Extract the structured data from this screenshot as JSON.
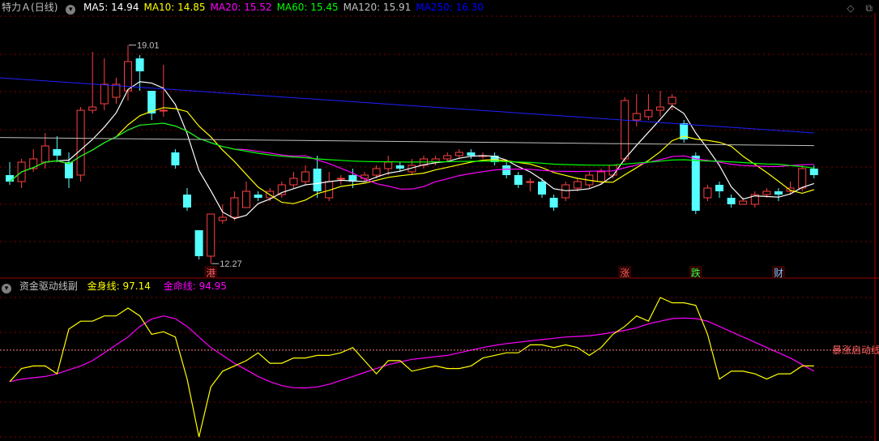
{
  "main_panel": {
    "stock_name": "特力Ａ",
    "period": "(日线)",
    "ma_items": [
      {
        "label": "MA5: ",
        "value": "14.94",
        "color": "#ffffff"
      },
      {
        "label": "MA10: ",
        "value": "14.85",
        "color": "#ffff00"
      },
      {
        "label": "MA20: ",
        "value": "15.52",
        "color": "#ff00ff"
      },
      {
        "label": "MA60: ",
        "value": "15.45",
        "color": "#00ff00"
      },
      {
        "label": "MA120: ",
        "value": "15.91",
        "color": "#c0c0c0"
      },
      {
        "label": "MA250: ",
        "value": "16.30",
        "color": "#0000ff"
      }
    ],
    "high_label": "19.01",
    "low_label": "12.27",
    "markers": [
      {
        "text": "港",
        "color": "#ff6060",
        "day": 17
      },
      {
        "text": "涨",
        "color": "#ff6060",
        "day": 52
      },
      {
        "text": "跌",
        "color": "#40ff40",
        "day": 58
      },
      {
        "text": "财",
        "color": "#80c0ff",
        "day": 65
      }
    ]
  },
  "sub_panel": {
    "indicator_name": "资金驱动线副",
    "line1_label": "金身线: ",
    "line1_value": "97.14",
    "line2_label": "金命线: ",
    "line2_value": "94.95",
    "annotation": "暴涨启动线"
  },
  "colors": {
    "up": "#ff4040",
    "down": "#54ffff",
    "ma5": "#ffffff",
    "ma10": "#ffff00",
    "ma20": "#ff00ff",
    "ma60": "#00ff00",
    "ma120": "#c0c0c0",
    "ma250": "#2020ff",
    "grid": "#800000",
    "gold_line": "#ffff00",
    "life_line": "#ff00ff"
  },
  "chart_data": [
    {
      "type": "candlestick",
      "ylim": [
        11.9,
        19.9
      ],
      "candles": [
        [
          15.0,
          14.8,
          15.4,
          14.7
        ],
        [
          14.8,
          15.4,
          15.5,
          14.6
        ],
        [
          15.2,
          15.5,
          15.8,
          15.1
        ],
        [
          15.4,
          15.9,
          16.3,
          15.2
        ],
        [
          15.8,
          15.6,
          16.2,
          15.4
        ],
        [
          15.4,
          14.9,
          15.7,
          14.6
        ],
        [
          15.0,
          17.0,
          17.1,
          14.8
        ],
        [
          17.0,
          17.1,
          18.8,
          16.9
        ],
        [
          17.2,
          17.8,
          18.6,
          17.0
        ],
        [
          17.4,
          17.8,
          18.0,
          17.2
        ],
        [
          17.6,
          18.5,
          19.01,
          17.3
        ],
        [
          18.6,
          18.2,
          18.7,
          17.6
        ],
        [
          17.6,
          16.9,
          17.4,
          16.7
        ],
        [
          17.0,
          17.0,
          18.4,
          16.8
        ],
        [
          15.7,
          15.3,
          15.8,
          15.2
        ],
        [
          14.4,
          14.0,
          14.6,
          13.9
        ],
        [
          13.3,
          12.5,
          13.3,
          12.4
        ],
        [
          12.5,
          13.8,
          13.8,
          12.27
        ],
        [
          13.6,
          13.7,
          14.1,
          13.5
        ],
        [
          13.7,
          14.3,
          14.5,
          13.6
        ],
        [
          14.0,
          14.5,
          14.8,
          14.0
        ],
        [
          14.4,
          14.3,
          14.5,
          14.2
        ],
        [
          14.3,
          14.5,
          14.6,
          14.2
        ],
        [
          14.4,
          14.7,
          14.8,
          14.3
        ],
        [
          14.7,
          14.9,
          15.1,
          14.6
        ],
        [
          14.8,
          15.1,
          15.3,
          14.7
        ],
        [
          15.2,
          14.5,
          15.6,
          14.3
        ],
        [
          14.3,
          14.8,
          15.1,
          14.2
        ],
        [
          14.9,
          14.9,
          15.0,
          14.7
        ],
        [
          15.0,
          14.8,
          15.2,
          14.6
        ],
        [
          14.9,
          15.0,
          15.1,
          14.8
        ],
        [
          15.0,
          15.2,
          15.3,
          14.9
        ],
        [
          15.2,
          15.4,
          15.6,
          15.0
        ],
        [
          15.3,
          15.2,
          15.4,
          15.1
        ],
        [
          15.1,
          15.3,
          15.5,
          15.0
        ],
        [
          15.3,
          15.5,
          15.6,
          15.2
        ],
        [
          15.4,
          15.5,
          15.6,
          15.3
        ],
        [
          15.5,
          15.6,
          15.7,
          15.4
        ],
        [
          15.6,
          15.7,
          15.8,
          15.5
        ],
        [
          15.7,
          15.6,
          15.8,
          15.5
        ],
        [
          15.6,
          15.6,
          15.7,
          15.5
        ],
        [
          15.6,
          15.4,
          15.7,
          15.3
        ],
        [
          15.3,
          15.0,
          15.4,
          14.9
        ],
        [
          15.0,
          14.7,
          15.1,
          14.6
        ],
        [
          14.8,
          14.8,
          14.9,
          14.5
        ],
        [
          14.8,
          14.4,
          14.9,
          14.3
        ],
        [
          14.3,
          14.0,
          14.4,
          13.9
        ],
        [
          14.3,
          14.7,
          14.8,
          14.2
        ],
        [
          14.6,
          14.8,
          14.9,
          14.5
        ],
        [
          14.7,
          15.0,
          15.1,
          14.6
        ],
        [
          14.8,
          15.1,
          15.2,
          14.7
        ],
        [
          15.0,
          15.3,
          15.3,
          14.9
        ],
        [
          15.5,
          17.3,
          17.4,
          15.4
        ],
        [
          16.7,
          16.9,
          17.5,
          16.5
        ],
        [
          16.8,
          17.0,
          17.5,
          16.7
        ],
        [
          17.0,
          17.1,
          17.6,
          16.8
        ],
        [
          17.2,
          17.4,
          17.5,
          17.0
        ],
        [
          16.6,
          16.1,
          16.7,
          16.0
        ],
        [
          15.6,
          13.9,
          15.7,
          13.8
        ],
        [
          14.3,
          14.6,
          14.7,
          14.2
        ],
        [
          14.7,
          14.5,
          14.8,
          14.3
        ],
        [
          14.3,
          14.1,
          14.4,
          14.0
        ],
        [
          14.1,
          14.2,
          14.3,
          14.1
        ],
        [
          14.1,
          14.4,
          14.5,
          14.0
        ],
        [
          14.4,
          14.5,
          14.6,
          14.3
        ],
        [
          14.5,
          14.4,
          14.6,
          14.2
        ],
        [
          14.5,
          14.6,
          14.8,
          14.4
        ],
        [
          14.6,
          15.2,
          15.3,
          14.5
        ],
        [
          15.2,
          15.0,
          15.3,
          14.9
        ]
      ]
    },
    {
      "type": "line",
      "series": [
        {
          "name": "金身线",
          "values": [
            13,
            18,
            19,
            19,
            16,
            33,
            36,
            36,
            38,
            38,
            41,
            38,
            31,
            32,
            30,
            14,
            -8,
            11,
            17,
            19,
            21,
            24,
            20,
            20,
            22,
            22,
            23,
            23,
            24,
            26,
            21,
            16,
            21,
            21,
            17,
            18,
            19,
            18,
            18,
            19,
            22,
            23,
            24,
            24,
            27,
            27,
            26,
            27,
            26,
            23,
            26,
            31,
            34,
            38,
            36,
            45,
            43,
            43,
            42,
            31,
            14,
            17,
            17,
            16,
            14,
            16,
            16,
            19,
            19
          ]
        },
        {
          "name": "金命线",
          "values": [
            13,
            14,
            14.5,
            15,
            16,
            17.5,
            19,
            21,
            24,
            27,
            30,
            34,
            36.8,
            38,
            37,
            34,
            30,
            26,
            23,
            20,
            17.5,
            15,
            13,
            11.5,
            10.7,
            10.6,
            11,
            12,
            13.5,
            15,
            16.5,
            18,
            19.5,
            20.5,
            21.5,
            22,
            22.5,
            23,
            24,
            25,
            26,
            26.8,
            27.5,
            28,
            28.5,
            29,
            29.5,
            30,
            30.2,
            30.5,
            31,
            31.8,
            32.5,
            33.5,
            35,
            36,
            37,
            37.2,
            37,
            36,
            34,
            32,
            30,
            28,
            26,
            24,
            22,
            19.5,
            17
          ]
        }
      ]
    }
  ]
}
